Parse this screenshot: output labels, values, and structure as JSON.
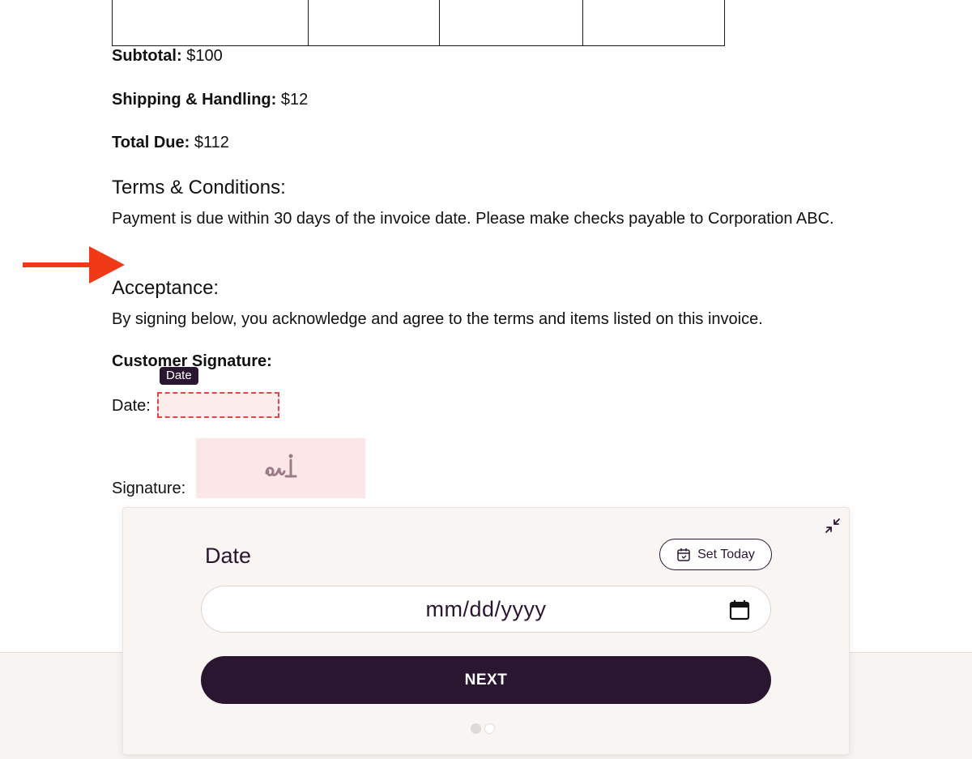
{
  "invoice": {
    "subtotal_label": "Subtotal:",
    "subtotal_value": " $100",
    "shipping_label": "Shipping & Handling:",
    "shipping_value": " $12",
    "total_label": "Total Due:",
    "total_value": " $112",
    "terms_heading": "Terms & Conditions:",
    "terms_text": "Payment is due within 30 days of the invoice date. Please make checks payable to Corporation ABC.",
    "acceptance_heading": "Acceptance:",
    "acceptance_text": "By signing below, you acknowledge and agree to the terms and items listed on this invoice.",
    "customer_signature_label": "Customer Signature:",
    "date_label": "Date:",
    "signature_label": "Signature:"
  },
  "fields": {
    "date_tag": "Date"
  },
  "panel": {
    "title": "Date",
    "set_today_label": "Set Today",
    "date_placeholder": "mm/dd/yyyy",
    "next_label": "NEXT",
    "step_current": 1,
    "step_total": 2
  },
  "colors": {
    "primary": "#2a1631",
    "field_border": "#e04848",
    "field_fill": "#fdecec",
    "signature_fill": "#fde6e8",
    "arrow": "#f03a17",
    "panel_bg": "#f9f5f2"
  },
  "icons": {
    "arrow": "red-arrow-right",
    "signature": "signature-pen-icon",
    "collapse": "collapse-arrows-icon",
    "calendar": "calendar-icon"
  }
}
